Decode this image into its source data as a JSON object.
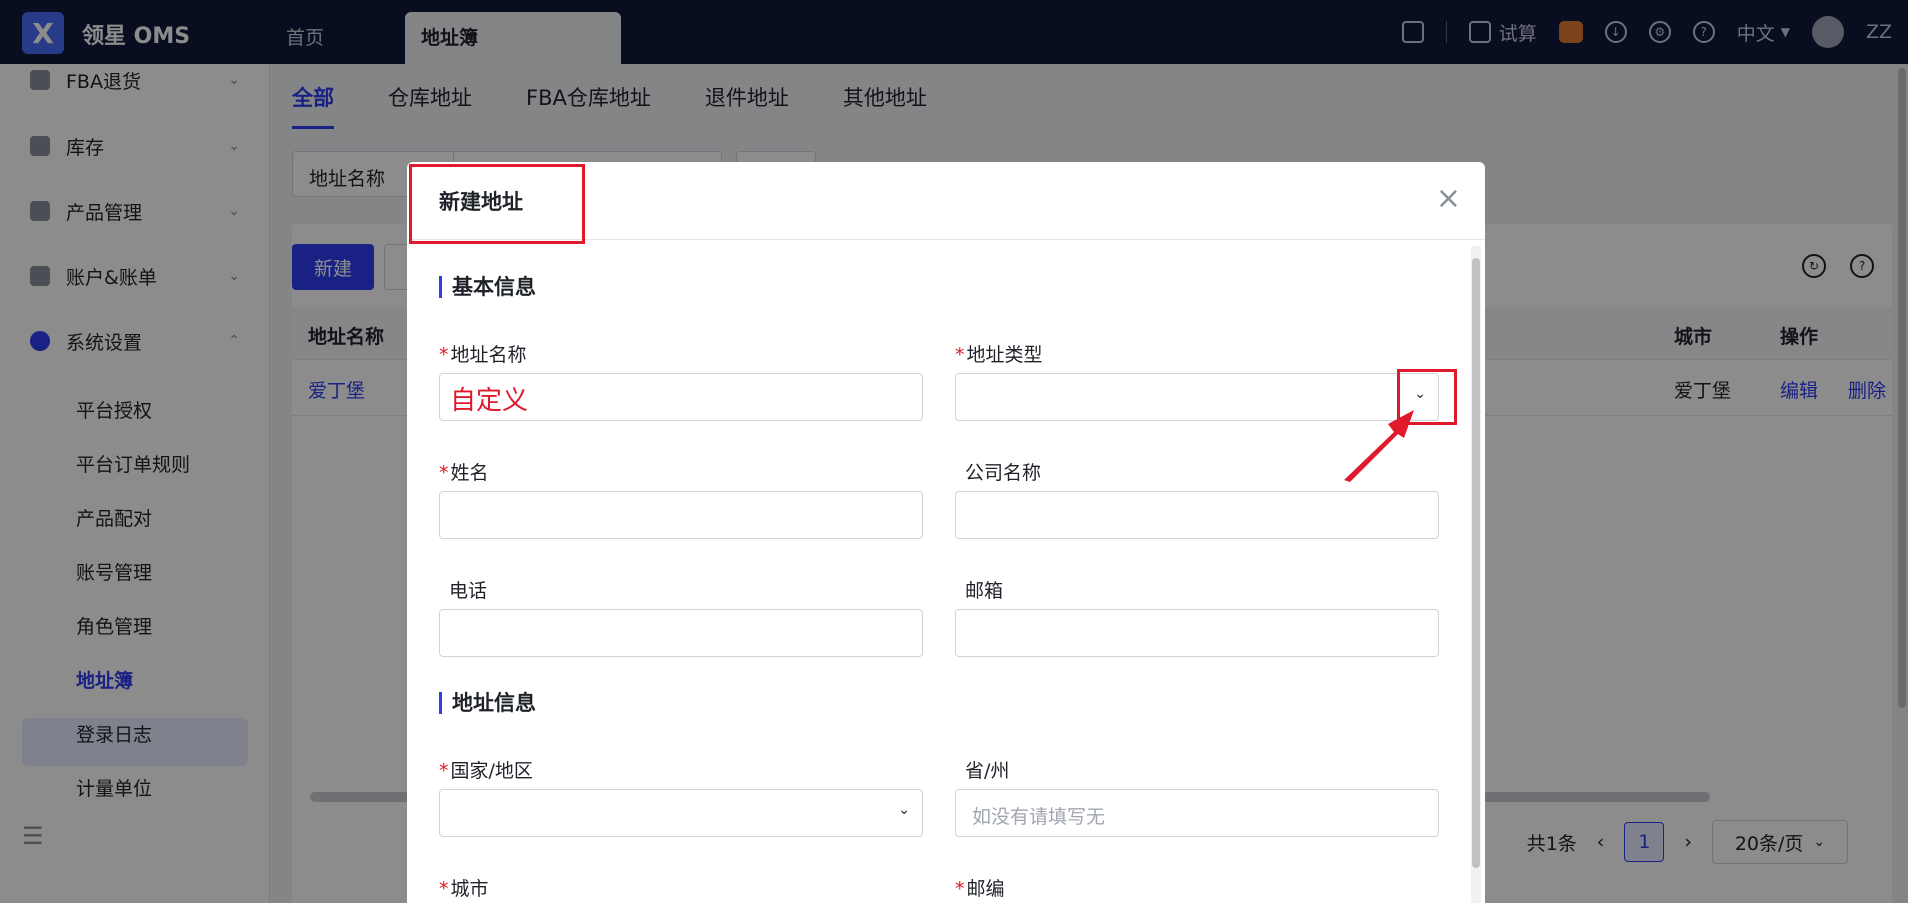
{
  "app": {
    "logo_letter": "X",
    "name": "领星 OMS"
  },
  "top_tabs": {
    "home": "首页",
    "active": "地址簿"
  },
  "top_right": {
    "calc": "试算",
    "language": "中文",
    "user": "ZZ"
  },
  "sidebar": {
    "groups": [
      {
        "label": "FBA退货",
        "icon": "return-icon"
      },
      {
        "label": "库存",
        "icon": "warehouse-icon"
      },
      {
        "label": "产品管理",
        "icon": "product-icon"
      },
      {
        "label": "账户&账单",
        "icon": "account-icon"
      },
      {
        "label": "系统设置",
        "icon": "settings-icon"
      }
    ],
    "sub_items": [
      "平台授权",
      "平台订单规则",
      "产品配对",
      "账号管理",
      "角色管理",
      "地址簿",
      "登录日志",
      "计量单位"
    ]
  },
  "sub_tabs": [
    "全部",
    "仓库地址",
    "FBA仓库地址",
    "退件地址",
    "其他地址"
  ],
  "filter": {
    "label": "地址名称"
  },
  "toolbar": {
    "new_label": "新建"
  },
  "table": {
    "headers": {
      "name": "地址名称",
      "city": "城市",
      "ops": "操作"
    },
    "rows": [
      {
        "name": "爱丁堡",
        "city": "爱丁堡",
        "edit": "编辑",
        "delete": "删除"
      }
    ]
  },
  "pager": {
    "total": "共1条",
    "page": "1",
    "size": "20条/页"
  },
  "modal": {
    "title": "新建地址",
    "section_basic": "基本信息",
    "section_address": "地址信息",
    "fields": {
      "address_name_label": "地址名称",
      "address_name_value": "自定义",
      "address_type_label": "地址类型",
      "name_label": "姓名",
      "company_label": "公司名称",
      "phone_label": "电话",
      "email_label": "邮箱",
      "country_label": "国家/地区",
      "province_label": "省/州",
      "province_placeholder": "如没有请填写无",
      "city_label": "城市",
      "zip_label": "邮编"
    }
  },
  "colors": {
    "primary": "#2f3cf0",
    "annotation": "#e0192b",
    "topbar": "#0f1a3a"
  }
}
